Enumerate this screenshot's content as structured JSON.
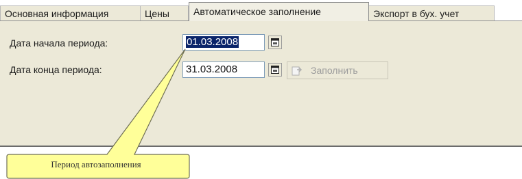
{
  "tabs": [
    {
      "label": "Основная информация"
    },
    {
      "label": "Цены"
    },
    {
      "label": "Автоматическое заполнение"
    },
    {
      "label": "Экспорт в бух. учет"
    }
  ],
  "active_tab": "Автоматическое заполнение",
  "form": {
    "start_label": "Дата начала периода:",
    "start_value": "01.03.2008",
    "end_label": "Дата конца периода:",
    "end_value": "31.03.2008",
    "fill_button": "Заполнить",
    "fill_button_enabled": false
  },
  "callout": {
    "text": "Период автозаполнения"
  },
  "colors": {
    "panel": "#ece9d8",
    "callout_fill": "#ffff99",
    "selection": "#0a246a"
  }
}
